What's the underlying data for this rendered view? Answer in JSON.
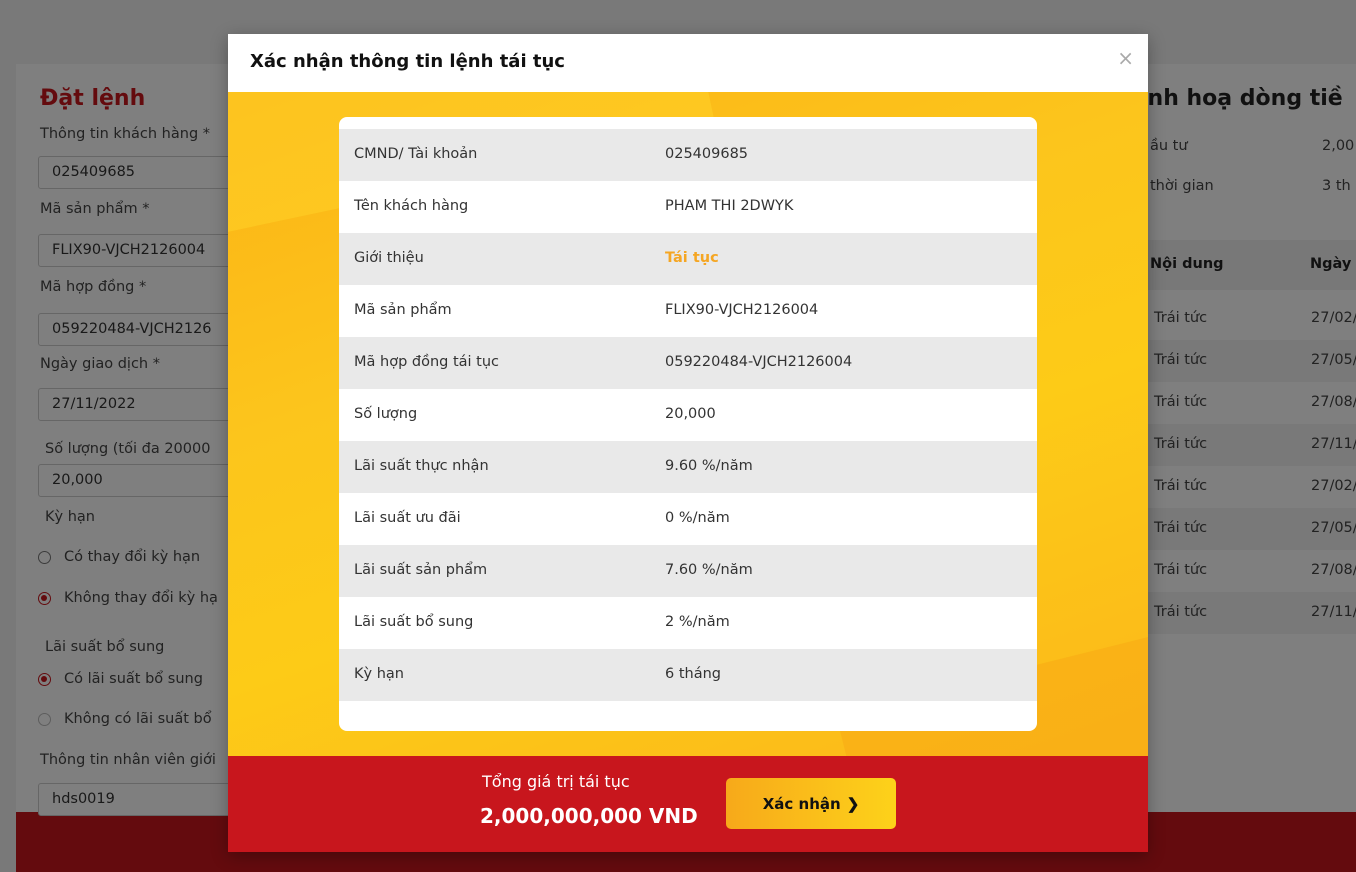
{
  "background": {
    "order_form": {
      "title": "Đặt lệnh",
      "customer_label": "Thông tin khách hàng *",
      "customer_value": "025409685",
      "product_label": "Mã sản phẩm *",
      "product_value": "FLIX90-VJCH2126004",
      "contract_label": "Mã hợp đồng *",
      "contract_value": "059220484-VJCH2126",
      "date_label": "Ngày giao dịch *",
      "date_value": "27/11/2022",
      "quantity_label": "Số lượng (tối đa 20000",
      "quantity_value": "20,000",
      "term_label": "Kỳ hạn",
      "term_option_change": "Có thay đổi kỳ hạn",
      "term_option_keep": "Không thay đổi kỳ hạ",
      "bonus_label": "Lãi suất bổ sung",
      "bonus_option_yes": "Có lãi suất bổ sung",
      "bonus_option_no": "Không có lãi suất bổ",
      "staff_label": "Thông tin nhân viên giới",
      "staff_value": "hds0019"
    },
    "cashflow": {
      "title": "inh hoạ dòng tiề",
      "invest_label": "ầu tư",
      "invest_value": "2,00",
      "duration_label": "thời gian",
      "duration_value": "3 th",
      "col_content": "Nội dung",
      "col_date": "Ngày",
      "rows": [
        {
          "content": "Trái tức",
          "date": "27/02/"
        },
        {
          "content": "Trái tức",
          "date": "27/05/"
        },
        {
          "content": "Trái tức",
          "date": "27/08/"
        },
        {
          "content": "Trái tức",
          "date": "27/11/"
        },
        {
          "content": "Trái tức",
          "date": "27/02/"
        },
        {
          "content": "Trái tức",
          "date": "27/05/"
        },
        {
          "content": "Trái tức",
          "date": "27/08/"
        },
        {
          "content": "Trái tức",
          "date": "27/11/"
        }
      ]
    }
  },
  "modal": {
    "title": "Xác nhận thông tin lệnh tái tục",
    "close_symbol": "×",
    "rows": [
      {
        "label": "CMND/ Tài khoản",
        "value": "025409685"
      },
      {
        "label": "Tên khách hàng",
        "value": "PHAM THI 2DWYK"
      },
      {
        "label": "Giới thiệu",
        "value": "Tái tục"
      },
      {
        "label": "Mã sản phẩm",
        "value": "FLIX90-VJCH2126004"
      },
      {
        "label": "Mã hợp đồng tái tục",
        "value": "059220484-VJCH2126004"
      },
      {
        "label": "Số lượng",
        "value": "20,000"
      },
      {
        "label": "Lãi suất thực nhận",
        "value": "9.60 %/năm"
      },
      {
        "label": "Lãi suất ưu đãi",
        "value": "0 %/năm"
      },
      {
        "label": "Lãi suất sản phẩm",
        "value": "7.60 %/năm"
      },
      {
        "label": "Lãi suất bổ sung",
        "value": "2 %/năm"
      },
      {
        "label": "Kỳ hạn",
        "value": "6 tháng"
      }
    ],
    "footer": {
      "total_label": "Tổng giá trị tái tục",
      "total_value": "2,000,000,000 VND",
      "confirm_label": "Xác nhận",
      "confirm_icon": "chevron-right-icon"
    }
  },
  "colors": {
    "brand_red": "#c8161d",
    "brand_yellow": "#fcc51c",
    "highlight_orange": "#f5a623"
  }
}
